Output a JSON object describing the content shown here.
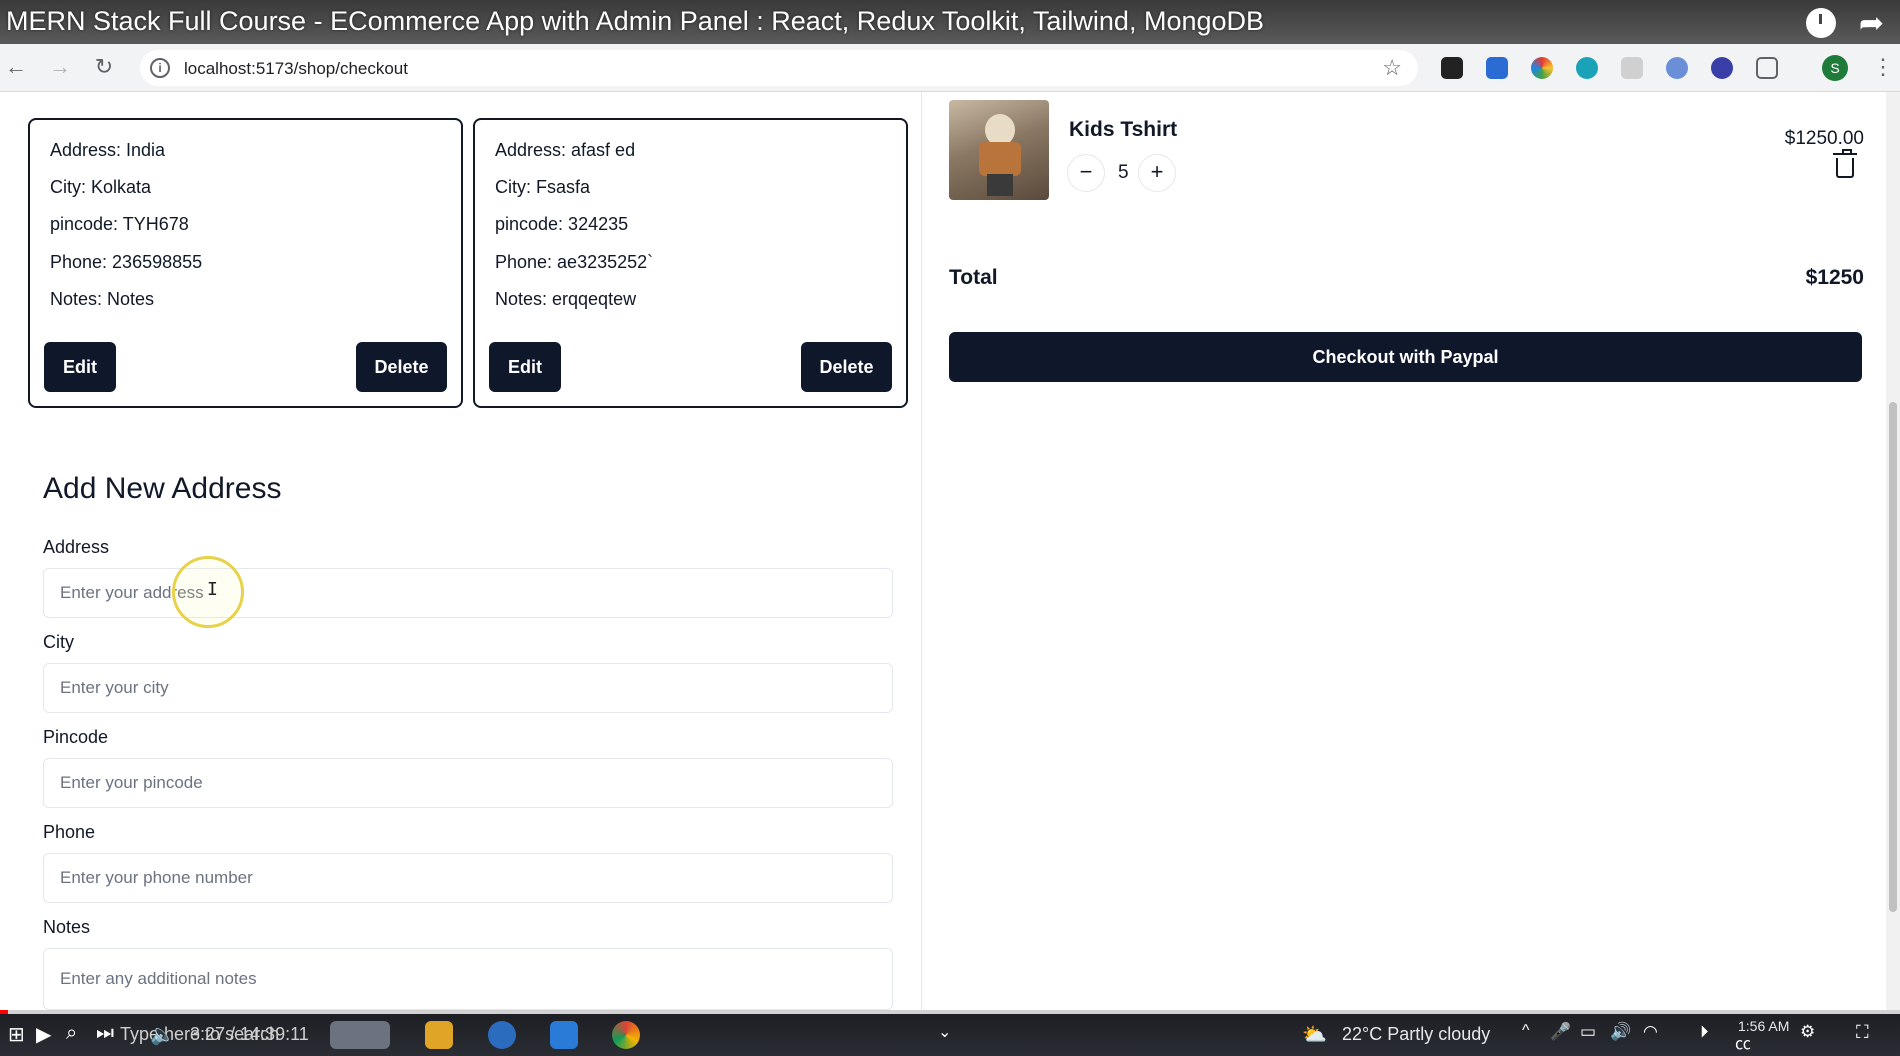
{
  "video": {
    "title": "MERN Stack Full Course - ECommerce App with Admin Panel : React, Redux Toolkit, Tailwind, MongoDB",
    "time": "3:27 / 14:39:11",
    "progress_fraction": 0.004
  },
  "browser": {
    "url": "localhost:5173/shop/checkout",
    "profile_initial": "S"
  },
  "addresses": [
    {
      "address": "Address: India",
      "city": "City: Kolkata",
      "pincode": "pincode: TYH678",
      "phone": "Phone: 236598855",
      "notes": "Notes: Notes",
      "edit_label": "Edit",
      "delete_label": "Delete"
    },
    {
      "address": "Address: afasf ed",
      "city": "City: Fsasfa",
      "pincode": "pincode: 324235",
      "phone": "Phone: ae3235252`",
      "notes": "Notes: erqqeqtew",
      "edit_label": "Edit",
      "delete_label": "Delete"
    }
  ],
  "form": {
    "title": "Add New Address",
    "fields": [
      {
        "label": "Address",
        "placeholder": "Enter your address",
        "value": ""
      },
      {
        "label": "City",
        "placeholder": "Enter your city",
        "value": ""
      },
      {
        "label": "Pincode",
        "placeholder": "Enter your pincode",
        "value": ""
      },
      {
        "label": "Phone",
        "placeholder": "Enter your phone number",
        "value": ""
      },
      {
        "label": "Notes",
        "placeholder": "Enter any additional notes",
        "value": ""
      }
    ]
  },
  "cart": {
    "item": {
      "name": "Kids Tshirt",
      "quantity": "5",
      "price": "$1250.00"
    },
    "total_label": "Total",
    "total_value": "$1250",
    "checkout_label": "Checkout with Paypal"
  },
  "taskbar": {
    "search_placeholder": "Type here to search",
    "weather": "22°C  Partly cloudy",
    "clock": "1:56 AM"
  },
  "colors": {
    "primary": "#0f172a",
    "border": "#e2e8f0"
  }
}
